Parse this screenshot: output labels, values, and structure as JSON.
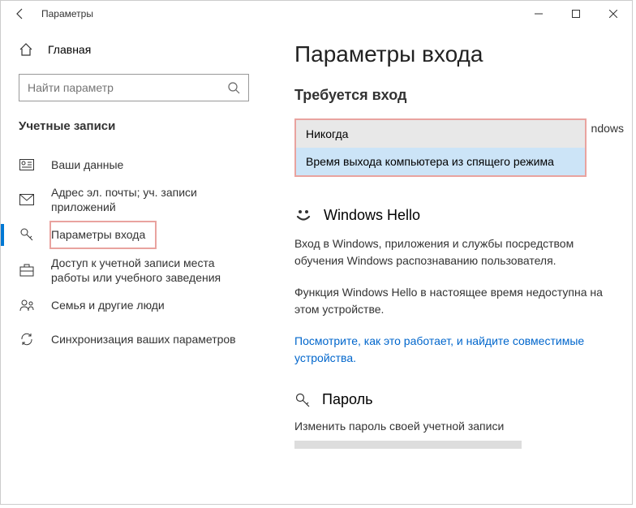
{
  "titlebar": {
    "title": "Параметры"
  },
  "sidebar": {
    "home": "Главная",
    "search_placeholder": "Найти параметр",
    "section": "Учетные записи",
    "items": [
      "Ваши данные",
      "Адрес эл. почты; уч. записи приложений",
      "Параметры входа",
      "Доступ к учетной записи места работы или учебного заведения",
      "Семья и другие люди",
      "Синхронизация ваших параметров"
    ]
  },
  "main": {
    "title": "Параметры входа",
    "require_signin": "Требуется вход",
    "truncated_text": "ndows",
    "dropdown": {
      "options": [
        "Никогда",
        "Время выхода компьютера из спящего режима"
      ]
    },
    "hello": {
      "title": "Windows Hello",
      "desc": "Вход в Windows, приложения и службы посредством обучения Windows распознаванию пользователя.",
      "unavail": "Функция Windows Hello в настоящее время недоступна на этом устройстве.",
      "link": "Посмотрите, как это работает, и найдите совместимые устройства."
    },
    "password": {
      "title": "Пароль",
      "desc": "Изменить пароль своей учетной записи"
    }
  }
}
